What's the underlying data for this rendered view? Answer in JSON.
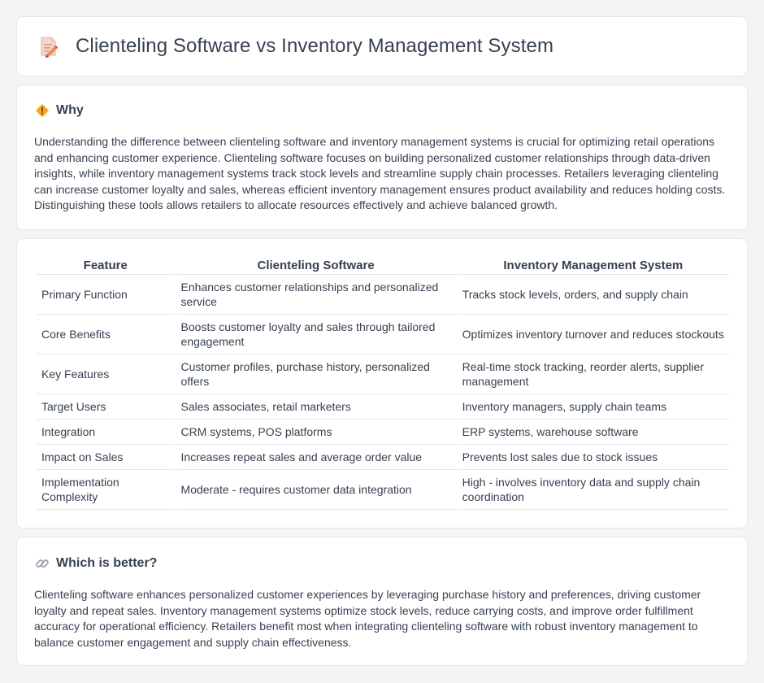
{
  "header": {
    "title": "Clienteling Software vs Inventory Management System",
    "icon": "document-pencil-icon"
  },
  "why": {
    "title": "Why",
    "icon": "diamond-warning-icon",
    "text": "Understanding the difference between clienteling software and inventory management systems is crucial for optimizing retail operations and enhancing customer experience. Clienteling software focuses on building personalized customer relationships through data-driven insights, while inventory management systems track stock levels and streamline supply chain processes. Retailers leveraging clienteling can increase customer loyalty and sales, whereas efficient inventory management ensures product availability and reduces holding costs. Distinguishing these tools allows retailers to allocate resources effectively and achieve balanced growth."
  },
  "comparison": {
    "headers": [
      "Feature",
      "Clienteling Software",
      "Inventory Management System"
    ],
    "rows": [
      [
        "Primary Function",
        "Enhances customer relationships and personalized service",
        "Tracks stock levels, orders, and supply chain"
      ],
      [
        "Core Benefits",
        "Boosts customer loyalty and sales through tailored engagement",
        "Optimizes inventory turnover and reduces stockouts"
      ],
      [
        "Key Features",
        "Customer profiles, purchase history, personalized offers",
        "Real-time stock tracking, reorder alerts, supplier management"
      ],
      [
        "Target Users",
        "Sales associates, retail marketers",
        "Inventory managers, supply chain teams"
      ],
      [
        "Integration",
        "CRM systems, POS platforms",
        "ERP systems, warehouse software"
      ],
      [
        "Impact on Sales",
        "Increases repeat sales and average order value",
        "Prevents lost sales due to stock issues"
      ],
      [
        "Implementation Complexity",
        "Moderate - requires customer data integration",
        "High - involves inventory data and supply chain coordination"
      ]
    ]
  },
  "better": {
    "title": "Which is better?",
    "icon": "link-icon",
    "text": "Clienteling software enhances personalized customer experiences by leveraging purchase history and preferences, driving customer loyalty and repeat sales. Inventory management systems optimize stock levels, reduce carrying costs, and improve order fulfillment accuracy for operational efficiency. Retailers benefit most when integrating clienteling software with robust inventory management to balance customer engagement and supply chain effectiveness."
  },
  "colors": {
    "background": "#f3f4f6",
    "card": "#ffffff",
    "border": "#e5e7eb",
    "text": "#374151",
    "accent": "#f59e0b"
  }
}
